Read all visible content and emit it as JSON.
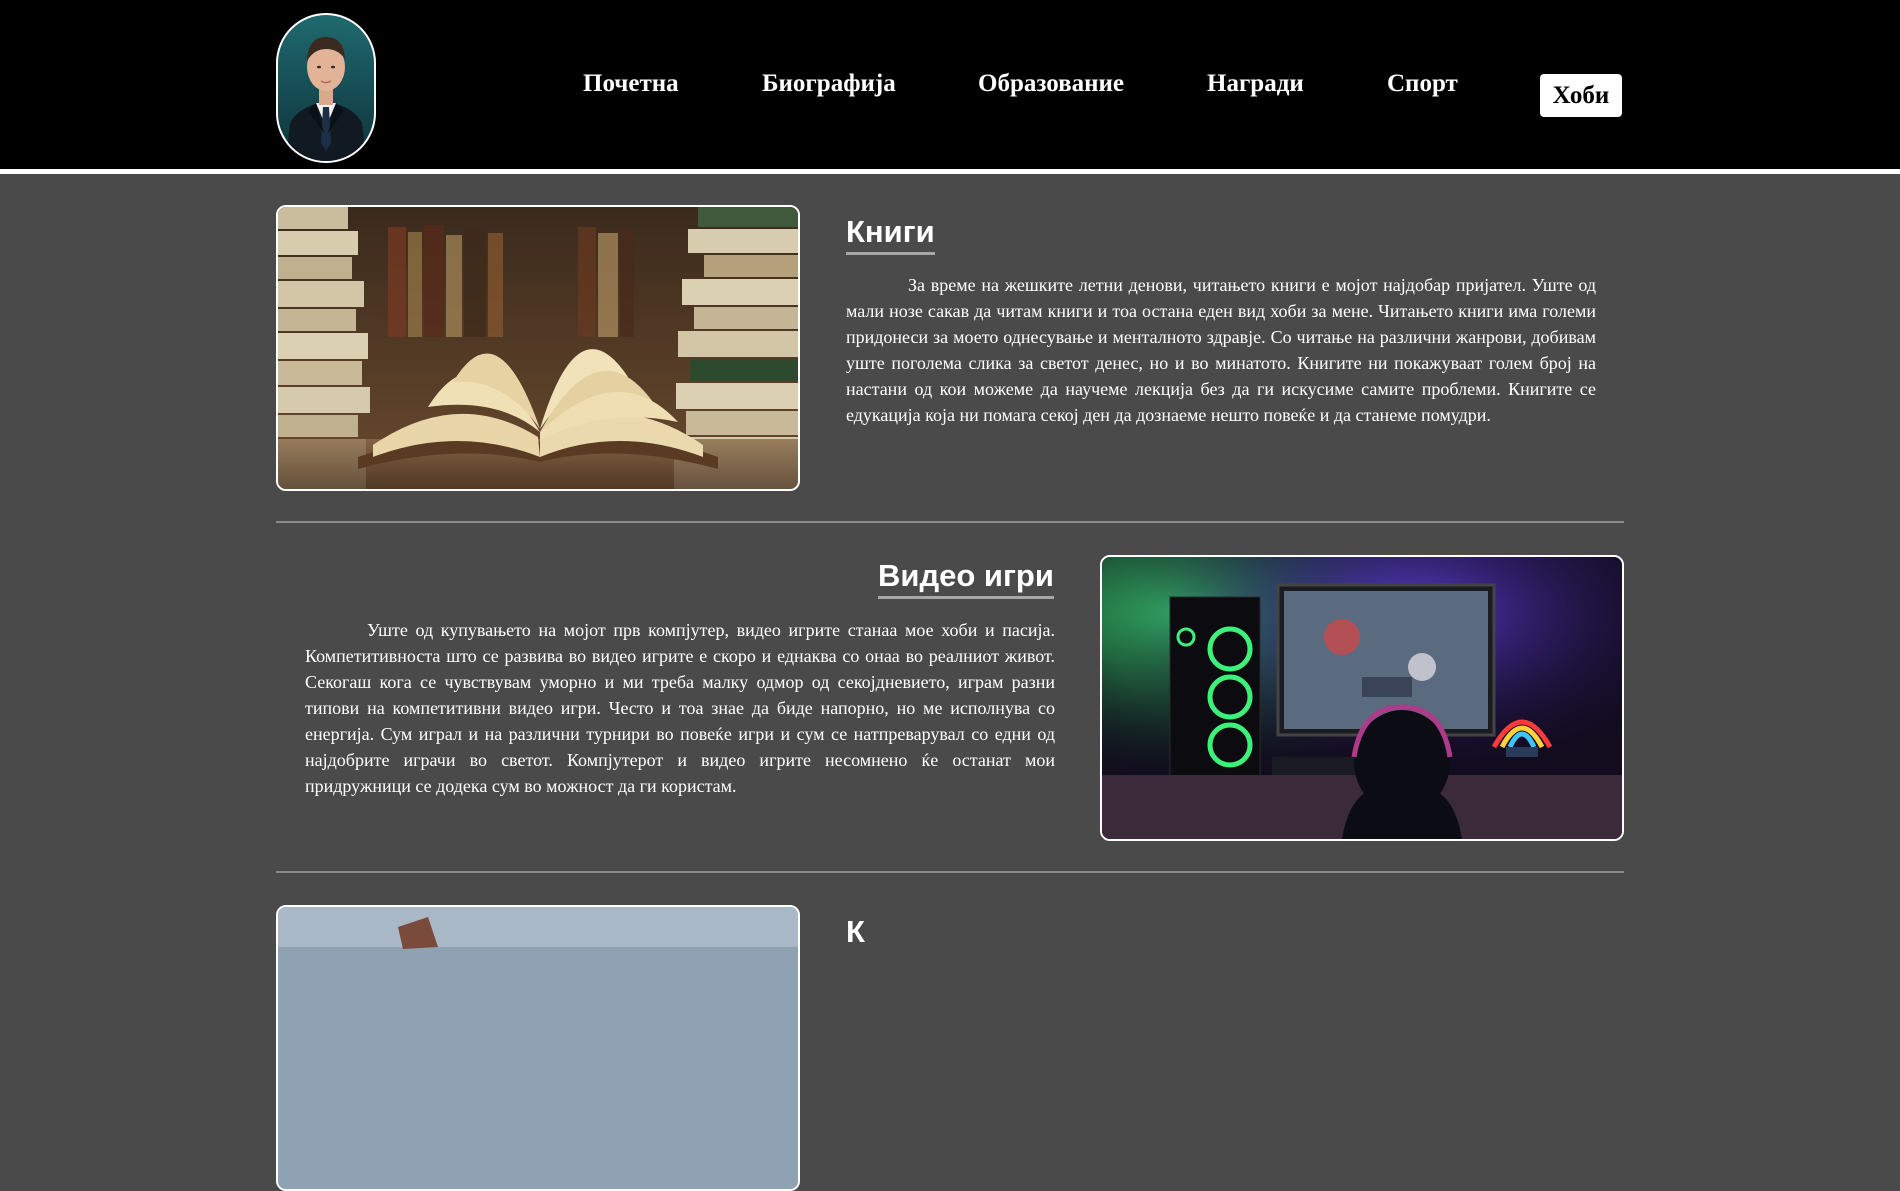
{
  "nav": {
    "items": [
      {
        "label": "Почетна"
      },
      {
        "label": "Биографија"
      },
      {
        "label": "Образование"
      },
      {
        "label": "Награди"
      },
      {
        "label": "Спорт"
      }
    ],
    "active_label": "Хоби"
  },
  "sections": [
    {
      "title": "Книги",
      "text": "За време на жешките летни денови, читањето книги е мојот најдобар пријател. Уште од мали нозе сакав да читам книги и тоа остана еден вид хоби за мене. Читањето книги има големи придонеси за моето однесување и менталното здравје. Со читање на различни жанрови, добивам уште поголема слика за светот денес, но и во минатото. Книгите ни покажуваат голем број на настани од кои можеме да научеме лекција без да ги искусиме самите проблеми. Книгите се едукација која ни помага секој ден да дознаеме нешто повеќе и да станеме помудри."
    },
    {
      "title": "Видео игри",
      "text": "Уште од купувањето на мојот прв компјутер, видео игрите станаа мое хоби и пасија. Компетитивноста што се развива во видео игрите е скоро и еднаква со онаа во реалниот живот. Секогаш кога се чувствувам уморно и ми треба малку одмор од секојдневието, играм разни типови на компетитивни видео игри. Често и тоа знае да биде напорно, но ме исполнува со енергија. Сум играл и на различни турнири во повеќе игри и сум се натпреварувал со едни од најдобрите играчи во светот. Компјутерот и видео игрите несомнено ќе останат мои придружници се додека сум во можност да ги користам."
    },
    {
      "title": "К"
    }
  ],
  "colors": {
    "header_bg": "#000000",
    "page_bg": "#4a4a4a",
    "active_bg": "#ffffff",
    "accent_underline": "#a7a7a7"
  },
  "icons": [
    "profile-photo",
    "books-photo",
    "gaming-setup-photo",
    "landscape-photo"
  ]
}
